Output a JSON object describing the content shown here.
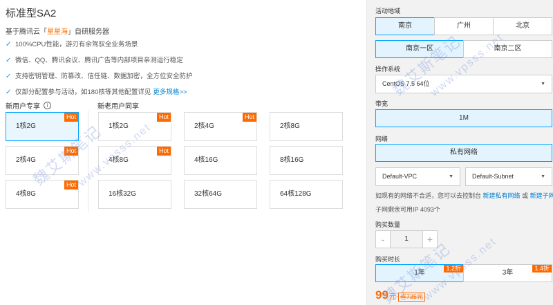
{
  "product": {
    "title": "标准型SA2",
    "subtitle_prefix": "基于腾讯云「",
    "subtitle_brand": "星星海",
    "subtitle_suffix": "」自研服务器"
  },
  "features": [
    {
      "text": "100%CPU性能，游刃有余驾驭全业务场景"
    },
    {
      "text": "微信、QQ、腾讯会议、腾讯广告等内部项目亲测运行稳定"
    },
    {
      "text": "支持密钥管理、防篡改、信任链、数据加密，全方位安全防护"
    },
    {
      "text": "仅部分配置参与活动，如180核等其他配置详见",
      "link": "更多规格>>"
    }
  ],
  "groups": {
    "new_user": "新用户专享",
    "all_user": "新老用户同享"
  },
  "hot_label": "Hot",
  "new_user_specs": [
    {
      "label": "1核2G",
      "hot": true,
      "selected": true
    },
    {
      "label": "2核4G",
      "hot": true,
      "selected": false
    },
    {
      "label": "4核8G",
      "hot": true,
      "selected": false
    }
  ],
  "all_user_specs": [
    {
      "label": "1核2G",
      "hot": true
    },
    {
      "label": "2核4G",
      "hot": true
    },
    {
      "label": "2核8G",
      "hot": false
    },
    {
      "label": "4核8G",
      "hot": true
    },
    {
      "label": "4核16G",
      "hot": false
    },
    {
      "label": "8核16G",
      "hot": false
    },
    {
      "label": "16核32G",
      "hot": false
    },
    {
      "label": "32核64G",
      "hot": false
    },
    {
      "label": "64核128G",
      "hot": false
    }
  ],
  "config": {
    "region_label": "活动地域",
    "regions": [
      {
        "label": "南京",
        "selected": true
      },
      {
        "label": "广州",
        "selected": false
      },
      {
        "label": "北京",
        "selected": false
      }
    ],
    "zones": [
      {
        "label": "南京一区",
        "selected": true
      },
      {
        "label": "南京二区",
        "selected": false
      }
    ],
    "os_label": "操作系统",
    "os_value": "CentOS 7.5 64位",
    "bandwidth_label": "带宽",
    "bandwidth_value": "1M",
    "network_label": "网络",
    "network_value": "私有网络",
    "vpc_value": "Default-VPC",
    "subnet_value": "Default-Subnet",
    "network_note": "如现有的网络不合适，您可以去控制台",
    "network_link1": "新建私有网络",
    "network_or": "或",
    "network_link2": "新建子网",
    "ip_note": "子网剩余可用IP 4093个",
    "qty_label": "购买数量",
    "qty_minus": "-",
    "qty_value": "1",
    "qty_plus": "+",
    "duration_label": "购买时长",
    "durations": [
      {
        "label": "1年",
        "discount": "1.2折",
        "selected": true
      },
      {
        "label": "3年",
        "discount": "1.4折",
        "selected": false
      }
    ],
    "price": "99",
    "price_unit": "元",
    "orig_price": "省735元"
  },
  "watermark": [
    "魏艾斯笔记",
    "www.vpsss.net"
  ],
  "colors": {
    "accent": "#00a4ff",
    "hot": "#ff6a00",
    "link": "#0080d0"
  }
}
